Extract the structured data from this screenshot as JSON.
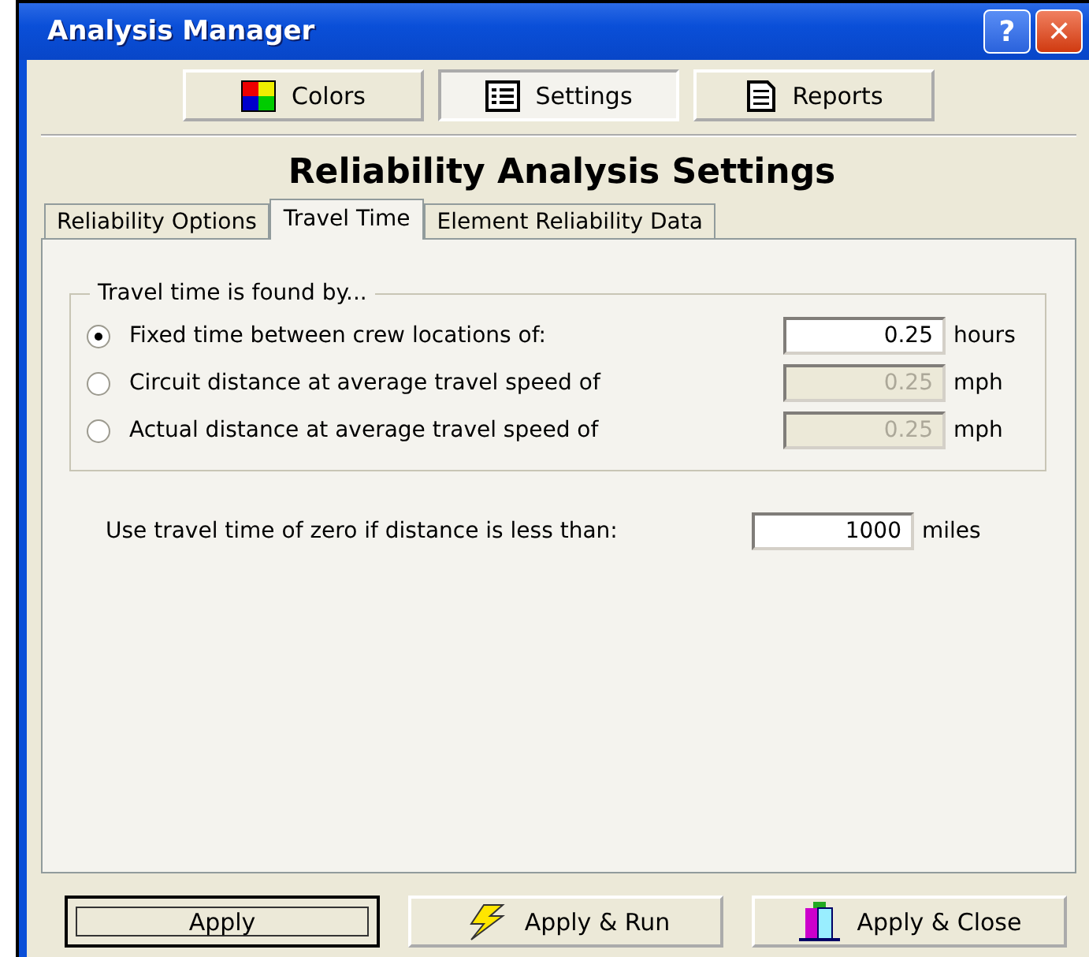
{
  "window": {
    "title": "Analysis Manager",
    "help_button": "?",
    "close_button": "✕"
  },
  "toolbar": [
    {
      "label": "Colors",
      "selected": false
    },
    {
      "label": "Settings",
      "selected": true
    },
    {
      "label": "Reports",
      "selected": false
    }
  ],
  "heading": "Reliability Analysis Settings",
  "tabs": [
    {
      "label": "Reliability Options",
      "selected": false
    },
    {
      "label": "Travel Time",
      "selected": true
    },
    {
      "label": "Element Reliability Data",
      "selected": false
    }
  ],
  "group": {
    "title": "Travel time is found by...",
    "options": [
      {
        "label": "Fixed time between crew locations of:",
        "selected": true,
        "value": "0.25",
        "unit": "hours",
        "disabled": false
      },
      {
        "label": "Circuit distance at average travel speed of",
        "selected": false,
        "value": "0.25",
        "unit": "mph",
        "disabled": true
      },
      {
        "label": "Actual distance at average travel speed of",
        "selected": false,
        "value": "0.25",
        "unit": "mph",
        "disabled": true
      }
    ]
  },
  "threshold": {
    "label": "Use travel time of zero if distance is less than:",
    "value": "1000",
    "unit": "miles"
  },
  "buttons": [
    {
      "label": "Apply",
      "focused": true
    },
    {
      "label": "Apply & Run",
      "focused": false
    },
    {
      "label": "Apply & Close",
      "focused": false
    }
  ]
}
